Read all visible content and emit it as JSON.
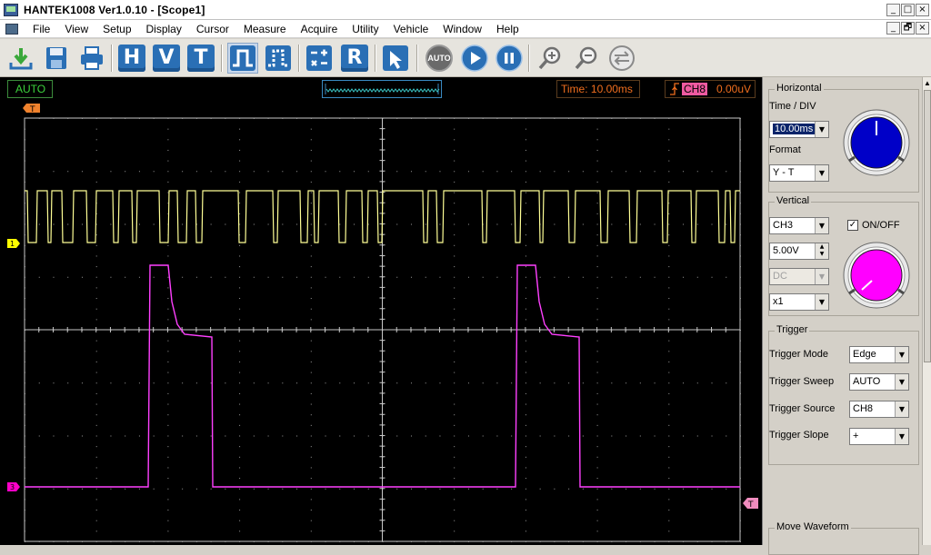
{
  "window": {
    "title": "HANTEK1008 Ver1.0.10 - [Scope1]",
    "controls": [
      "_",
      "□",
      "×"
    ]
  },
  "menu": {
    "items": [
      "File",
      "View",
      "Setup",
      "Display",
      "Cursor",
      "Measure",
      "Acquire",
      "Utility",
      "Vehicle",
      "Window",
      "Help"
    ],
    "doc_controls": [
      "_",
      "🗗",
      "×"
    ]
  },
  "toolbar": {
    "h_label": "H",
    "v_label": "V",
    "t_label": "T",
    "r_label": "R",
    "auto_label": "AUTO"
  },
  "status": {
    "mode": "AUTO",
    "time": "Time: 10.00ms",
    "trigger_channel": "CH8",
    "trigger_level": "0.00uV"
  },
  "scope": {
    "trigger_marker": "T",
    "ch1_marker": "1",
    "ch3_marker": "3",
    "trigger_level_marker": "T",
    "colors": {
      "ch1": "#ffff96",
      "ch3": "#ff40ff",
      "grid": "#c8c8c8"
    }
  },
  "horizontal": {
    "legend": "Horizontal",
    "time_div_label": "Time / DIV",
    "time_div_value": "10.00ms",
    "format_label": "Format",
    "format_value": "Y - T",
    "knob_color": "#0000c8"
  },
  "vertical": {
    "legend": "Vertical",
    "channel_value": "CH3",
    "onoff_label": "ON/OFF",
    "volts_value": "5.00V",
    "coupling_value": "DC",
    "probe_value": "x1",
    "knob_color": "#ff00ff"
  },
  "trigger": {
    "legend": "Trigger",
    "mode_label": "Trigger Mode",
    "mode_value": "Edge",
    "sweep_label": "Trigger Sweep",
    "sweep_value": "AUTO",
    "source_label": "Trigger Source",
    "source_value": "CH8",
    "slope_label": "Trigger Slope",
    "slope_value": "+"
  },
  "move_waveform": {
    "legend": "Move Waveform"
  }
}
